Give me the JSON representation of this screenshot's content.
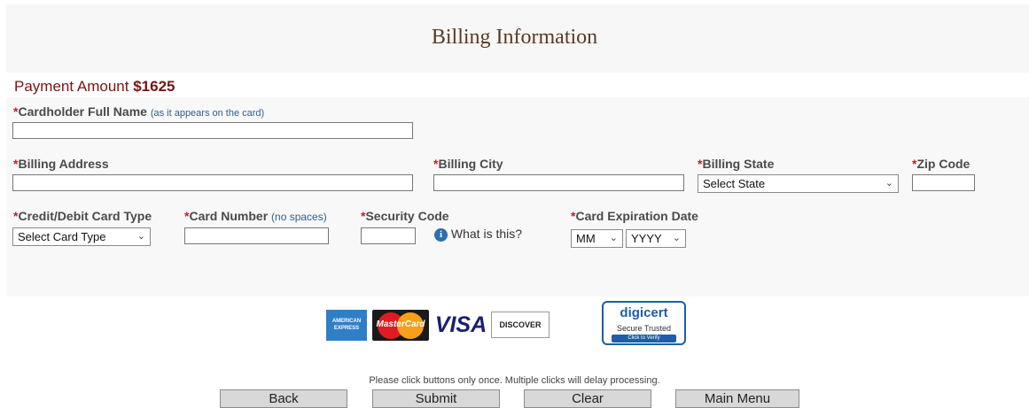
{
  "page": {
    "title": "Billing Information",
    "payment_label": "Payment Amount",
    "payment_amount": "$1625"
  },
  "form": {
    "required_mark": "*",
    "cardholder": {
      "label": "Cardholder Full Name",
      "hint": "(as it appears on the card)",
      "value": ""
    },
    "address": {
      "label": "Billing Address",
      "value": ""
    },
    "city": {
      "label": "Billing City",
      "value": ""
    },
    "state": {
      "label": "Billing State",
      "selected": "Select State"
    },
    "zip": {
      "label": "Zip Code",
      "value": ""
    },
    "card_type": {
      "label": "Credit/Debit Card Type",
      "selected": "Select Card Type"
    },
    "card_number": {
      "label": "Card Number",
      "hint": "(no spaces)",
      "value": ""
    },
    "security_code": {
      "label": "Security Code",
      "value": "",
      "help": "What is this?"
    },
    "expiration": {
      "label": "Card Expiration Date",
      "month": "MM",
      "year": "YYYY"
    }
  },
  "logos": {
    "amex": "AMERICAN EXPRESS",
    "mastercard": "MasterCard",
    "visa": "VISA",
    "discover": "DISCOVER",
    "digicert_brand": "digicert",
    "digicert_sub": "Secure Trusted",
    "digicert_action": "Click to Verify"
  },
  "notice": "Please click buttons only once. Multiple clicks will delay processing.",
  "buttons": {
    "back": "Back",
    "submit": "Submit",
    "clear": "Clear",
    "main_menu": "Main Menu"
  },
  "colors": {
    "title": "#5a3a1e",
    "payment": "#7a1313",
    "required": "#c0202a",
    "hint": "#2f5e8e"
  }
}
